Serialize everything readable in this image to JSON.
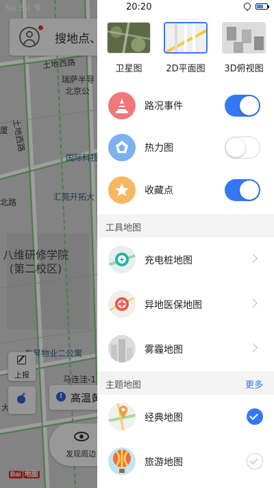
{
  "status_bar": {
    "left_indicators": "Sil Sil 令",
    "time": "20:20"
  },
  "map": {
    "search_placeholder": "搜地点、",
    "labels": {
      "street1": "土地西路",
      "street2": "土地西路",
      "poi_ruisa": "瑞萨半导",
      "poi_bjgs": "北京公",
      "poi_xia": "厦",
      "poi_guoji": "国际科技",
      "poi_huiyuan": "汇苑开拓大",
      "street_bei": "北路",
      "school": "八维研修学院\n(第二校区)",
      "poi_dongsheng": "东昇物业二公寓",
      "road_malian": "马连洼-1",
      "road_da": "大"
    },
    "report_label": "上报",
    "weather_icon": "!",
    "weather_text": "高温黄",
    "discover_label": "发现周边",
    "logo_text": "Bai",
    "logo_badge": "地图"
  },
  "panel": {
    "map_types": [
      {
        "label": "卫星图",
        "selected": false,
        "thumb": "satellite"
      },
      {
        "label": "2D平面图",
        "selected": true,
        "thumb": "flat"
      },
      {
        "label": "3D俯视图",
        "selected": false,
        "thumb": "3d"
      }
    ],
    "layers": [
      {
        "label": "路况事件",
        "icon": "traffic-cone-icon",
        "icon_color": "#f0787a",
        "on": true
      },
      {
        "label": "热力图",
        "icon": "pentagon-icon",
        "icon_color": "#7cb2ee",
        "on": false
      },
      {
        "label": "收藏点",
        "icon": "star-icon",
        "icon_color": "#f8b760",
        "on": true
      }
    ],
    "tool_section": {
      "title": "工具地图"
    },
    "tool_maps": [
      {
        "label": "充电桩地图",
        "icon": "charging-pile-icon"
      },
      {
        "label": "异地医保地图",
        "icon": "medical-insurance-icon"
      },
      {
        "label": "雾霾地图",
        "icon": "haze-icon"
      }
    ],
    "theme_section": {
      "title": "主题地图",
      "more": "更多"
    },
    "theme_maps": [
      {
        "label": "经典地图",
        "icon": "classic-map-icon",
        "checked": true
      },
      {
        "label": "旅游地图",
        "icon": "hot-air-balloon-icon",
        "checked": false
      }
    ],
    "accent_color": "#3478f6"
  }
}
